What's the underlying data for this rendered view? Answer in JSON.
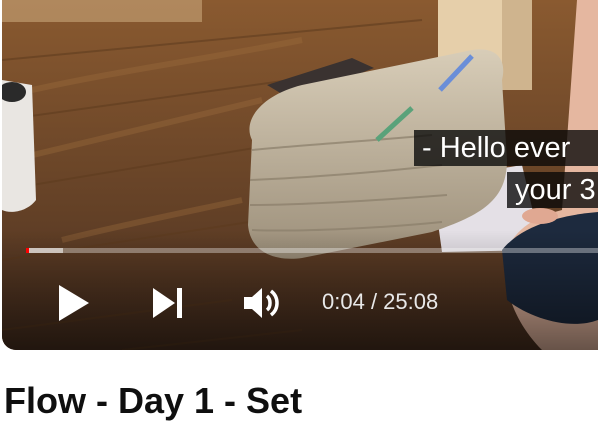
{
  "player": {
    "captions": [
      "- Hello ever",
      "your 3"
    ],
    "progress": {
      "played_fraction": 0.003,
      "loaded_fraction": 0.065
    },
    "controls": {
      "play_icon": "play-icon",
      "next_icon": "skip-next-icon",
      "volume_icon": "volume-icon"
    },
    "time": {
      "current": "0:04",
      "separator": " / ",
      "duration": "25:08"
    }
  },
  "video": {
    "title": "Flow - Day 1 - Set"
  },
  "colors": {
    "progress_played": "#ff0000",
    "title_text": "#0f0f0f"
  }
}
